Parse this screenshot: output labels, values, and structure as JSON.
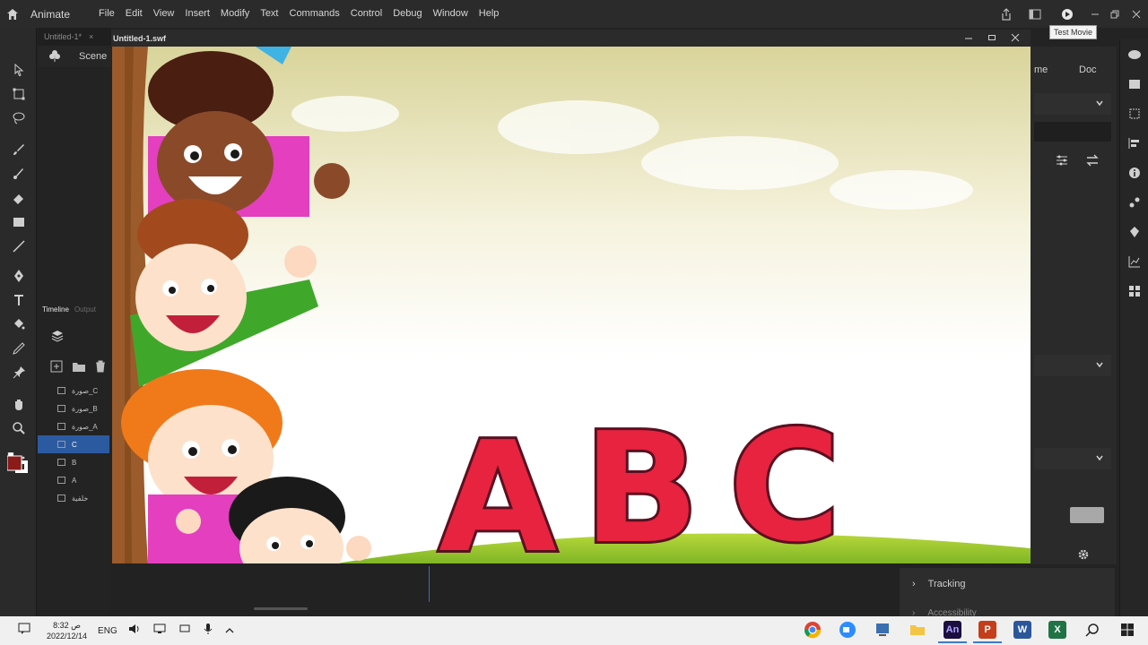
{
  "app": {
    "name": "Animate"
  },
  "menu": [
    "File",
    "Edit",
    "View",
    "Insert",
    "Modify",
    "Text",
    "Commands",
    "Control",
    "Debug",
    "Window",
    "Help"
  ],
  "tooltip": "Test Movie",
  "document_tab": {
    "title": "Untitled-1*",
    "close": "×"
  },
  "scene": {
    "label": "Scene"
  },
  "swf_window": {
    "title": "Untitled-1.swf"
  },
  "stage": {
    "letters": [
      "A",
      "B",
      "C"
    ]
  },
  "timeline": {
    "tabs": [
      "Timeline",
      "Output"
    ],
    "layers": [
      {
        "name": "صورة_C",
        "selected": false
      },
      {
        "name": "صورة_B",
        "selected": false
      },
      {
        "name": "صورة_A",
        "selected": false
      },
      {
        "name": "C",
        "selected": true
      },
      {
        "name": "B",
        "selected": false
      },
      {
        "name": "A",
        "selected": false
      },
      {
        "name": "خلفية",
        "selected": false
      }
    ]
  },
  "properties": {
    "tabs": [
      "me",
      "Doc"
    ],
    "tracking": "Tracking",
    "accessibility": "Accessibility"
  },
  "colors": {
    "accent": "#2c5aa0",
    "fill": "#8b1a1a",
    "letter_red": "#e8233f"
  },
  "taskbar": {
    "time": "8:32 ص",
    "date": "2022/12/14",
    "lang": "ENG",
    "apps": [
      "chrome",
      "zoom",
      "network",
      "files",
      "An",
      "P",
      "W",
      "X",
      "search",
      "windows"
    ]
  }
}
